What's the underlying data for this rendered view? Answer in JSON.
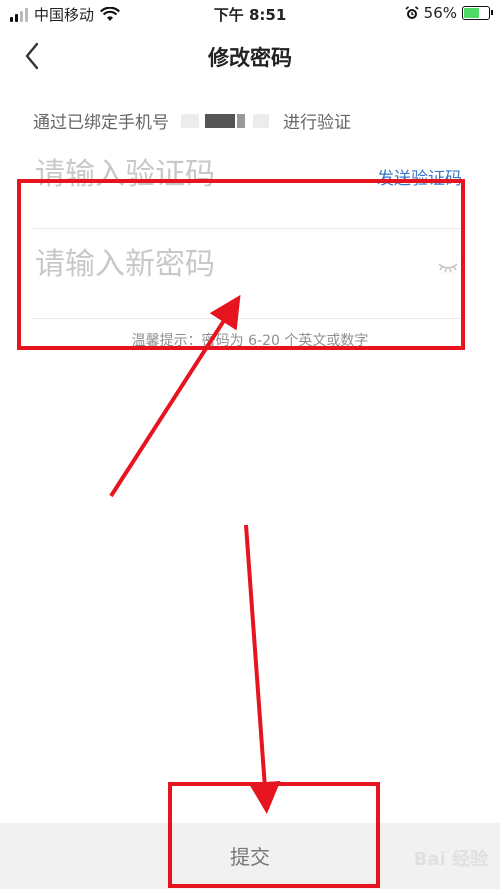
{
  "status_bar": {
    "carrier": "中国移动",
    "time": "下午 8:51",
    "battery": "56%",
    "battery_level": 0.56
  },
  "nav": {
    "title": "修改密码"
  },
  "verify": {
    "prefix": "通过已绑定手机号",
    "suffix": "进行验证"
  },
  "code_field": {
    "placeholder": "请输入验证码",
    "send_label": "发送验证码"
  },
  "password_field": {
    "placeholder": "请输入新密码"
  },
  "hint": "温馨提示：密码为 6-20 个英文或数字",
  "submit_label": "提交",
  "watermark": "Bai 经验",
  "colors": {
    "annotation": "#e5141f",
    "link": "#3a78c9",
    "bottom_bar": "#f1f1f1"
  }
}
